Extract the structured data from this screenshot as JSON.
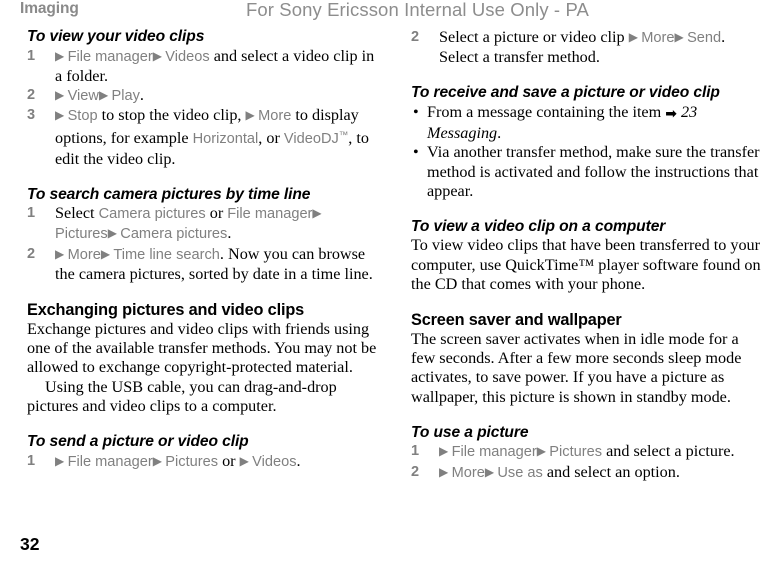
{
  "header": {
    "running_head": "Imaging",
    "watermark": "For Sony Ericsson Internal Use Only - PA"
  },
  "footer": {
    "page_number": "32"
  },
  "glyphs": {
    "menu_arrow": "▶",
    "bullet": "•",
    "xref_arrow": "➡",
    "trademark": "™"
  },
  "left_column": {
    "block1": {
      "heading": "To view your video clips",
      "steps": [
        {
          "num": "1",
          "parts": [
            {
              "t": "arrow"
            },
            {
              "t": "menu",
              "v": "File manager"
            },
            {
              "t": "arrow"
            },
            {
              "t": "menu",
              "v": "Videos"
            },
            {
              "t": "text",
              "v": " and select a video clip in a folder."
            }
          ]
        },
        {
          "num": "2",
          "parts": [
            {
              "t": "arrow"
            },
            {
              "t": "menu",
              "v": "View"
            },
            {
              "t": "arrow"
            },
            {
              "t": "menu",
              "v": "Play"
            },
            {
              "t": "text",
              "v": "."
            }
          ]
        },
        {
          "num": "3",
          "parts": [
            {
              "t": "arrow"
            },
            {
              "t": "menu",
              "v": "Stop"
            },
            {
              "t": "text",
              "v": " to stop the video clip, "
            },
            {
              "t": "arrow"
            },
            {
              "t": "menu",
              "v": "More"
            },
            {
              "t": "text",
              "v": " to display options, for example "
            },
            {
              "t": "menu",
              "v": "Horizontal"
            },
            {
              "t": "text",
              "v": ", or "
            },
            {
              "t": "menu-tm",
              "v": "VideoDJ"
            },
            {
              "t": "text",
              "v": ", to edit the video clip."
            }
          ]
        }
      ]
    },
    "block2": {
      "heading": "To search camera pictures by time line",
      "steps": [
        {
          "num": "1",
          "parts": [
            {
              "t": "text",
              "v": "Select "
            },
            {
              "t": "menu",
              "v": "Camera pictures"
            },
            {
              "t": "text",
              "v": " or "
            },
            {
              "t": "menu",
              "v": "File manager"
            },
            {
              "t": "arrow"
            },
            {
              "t": "menu",
              "v": "Pictures"
            },
            {
              "t": "arrow"
            },
            {
              "t": "menu",
              "v": "Camera pictures"
            },
            {
              "t": "text",
              "v": "."
            }
          ]
        },
        {
          "num": "2",
          "parts": [
            {
              "t": "arrow"
            },
            {
              "t": "menu",
              "v": "More"
            },
            {
              "t": "arrow"
            },
            {
              "t": "menu",
              "v": "Time line search"
            },
            {
              "t": "text",
              "v": ". Now you can browse the camera pictures, sorted by date in a time line."
            }
          ]
        }
      ]
    },
    "block3": {
      "heading": "Exchanging pictures and video clips",
      "paragraph1": "Exchange pictures and video clips with friends using one of the available transfer methods. You may not be allowed to exchange copyright-protected material.",
      "paragraph2": "Using the USB cable, you can drag-and-drop pictures and video clips to a computer."
    },
    "block4": {
      "heading": "To send a picture or video clip",
      "steps": [
        {
          "num": "1",
          "parts": [
            {
              "t": "arrow"
            },
            {
              "t": "menu",
              "v": "File manager"
            },
            {
              "t": "arrow"
            },
            {
              "t": "menu",
              "v": "Pictures"
            },
            {
              "t": "text",
              "v": " or "
            },
            {
              "t": "arrow"
            },
            {
              "t": "menu",
              "v": "Videos"
            },
            {
              "t": "text",
              "v": "."
            }
          ]
        }
      ]
    }
  },
  "right_column": {
    "block1": {
      "steps": [
        {
          "num": "2",
          "parts": [
            {
              "t": "text",
              "v": "Select a picture or video clip "
            },
            {
              "t": "arrow"
            },
            {
              "t": "menu",
              "v": "More"
            },
            {
              "t": "arrow"
            },
            {
              "t": "menu",
              "v": "Send"
            },
            {
              "t": "text",
              "v": ". Select a transfer method."
            }
          ]
        }
      ]
    },
    "block2": {
      "heading": "To receive and save a picture or video clip",
      "bullets": [
        {
          "parts": [
            {
              "t": "text",
              "v": "From a message containing the item "
            },
            {
              "t": "xref"
            },
            {
              "t": "italic",
              "v": " 23 Messaging"
            },
            {
              "t": "text",
              "v": "."
            }
          ]
        },
        {
          "parts": [
            {
              "t": "text",
              "v": "Via another transfer method, make sure the transfer method is activated and follow the instructions that appear."
            }
          ]
        }
      ]
    },
    "block3": {
      "heading": "To view a video clip on a computer",
      "paragraph": "To view video clips that have been transferred to your computer, use QuickTime™ player software found on the CD that comes with your phone."
    },
    "block4": {
      "heading": "Screen saver and wallpaper",
      "paragraph": "The screen saver activates when in idle mode for a few seconds. After a few more seconds sleep mode activates, to save power. If you have a picture as wallpaper, this picture is shown in standby mode."
    },
    "block5": {
      "heading": "To use a picture",
      "steps": [
        {
          "num": "1",
          "parts": [
            {
              "t": "arrow"
            },
            {
              "t": "menu",
              "v": "File manager"
            },
            {
              "t": "arrow"
            },
            {
              "t": "menu",
              "v": "Pictures"
            },
            {
              "t": "text",
              "v": " and select a picture."
            }
          ]
        },
        {
          "num": "2",
          "parts": [
            {
              "t": "arrow"
            },
            {
              "t": "menu",
              "v": "More"
            },
            {
              "t": "arrow"
            },
            {
              "t": "menu",
              "v": "Use as"
            },
            {
              "t": "text",
              "v": " and select an option."
            }
          ]
        }
      ]
    }
  }
}
